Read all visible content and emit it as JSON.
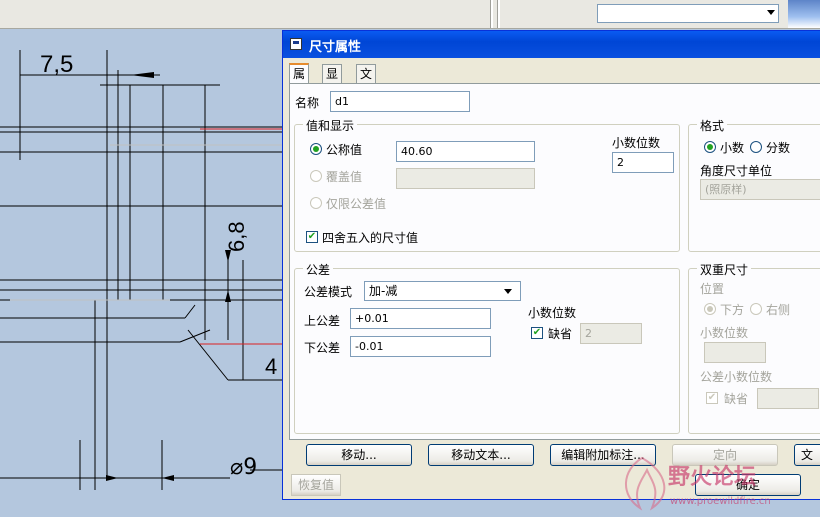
{
  "cad": {
    "dim_top": "7,5",
    "dim_vertical": "6,8",
    "dim_4": "4",
    "dim_bottom": "⌀9"
  },
  "topbar": {
    "combo_value": ""
  },
  "dialog": {
    "title": "尺寸属性",
    "tabs": [
      {
        "label": "属性"
      },
      {
        "label": "显示"
      },
      {
        "label": "文本样式"
      }
    ],
    "name_label": "名称",
    "name_value": "d1",
    "value_group": {
      "title": "值和显示",
      "nominal_label": "公称值",
      "nominal_value": "40.60",
      "override_label": "覆盖值",
      "override_value": "",
      "tol_only_label": "仅限公差值",
      "round_label": "四舍五入的尺寸值",
      "decimals_label": "小数位数",
      "decimals_value": "2"
    },
    "format_group": {
      "title": "格式",
      "decimal_label": "小数",
      "fraction_label": "分数",
      "angle_unit_label": "角度尺寸单位",
      "angle_unit_value": "(照原样)"
    },
    "tolerance_group": {
      "title": "公差",
      "mode_label": "公差模式",
      "mode_value": "加-减",
      "upper_label": "上公差",
      "upper_value": "+0.01",
      "lower_label": "下公差",
      "lower_value": "-0.01",
      "decimals_label": "小数位数",
      "default_label": "缺省",
      "decimals_value": "2"
    },
    "dual_group": {
      "title": "双重尺寸",
      "position_label": "位置",
      "below_label": "下方",
      "right_label": "右侧",
      "decimals_label": "小数位数",
      "decimals_value": "",
      "tol_decimals_label": "公差小数位数",
      "default_label": "缺省",
      "tol_decimals_value": ""
    },
    "buttons": {
      "move": "移动...",
      "move_text": "移动文本...",
      "edit_attached": "编辑附加标注...",
      "orient": "定向",
      "text_cut": "文",
      "restore": "恢复值",
      "ok": "确定"
    }
  },
  "watermark": {
    "text": "野火论坛",
    "url": "www.proewildfire.cn"
  }
}
